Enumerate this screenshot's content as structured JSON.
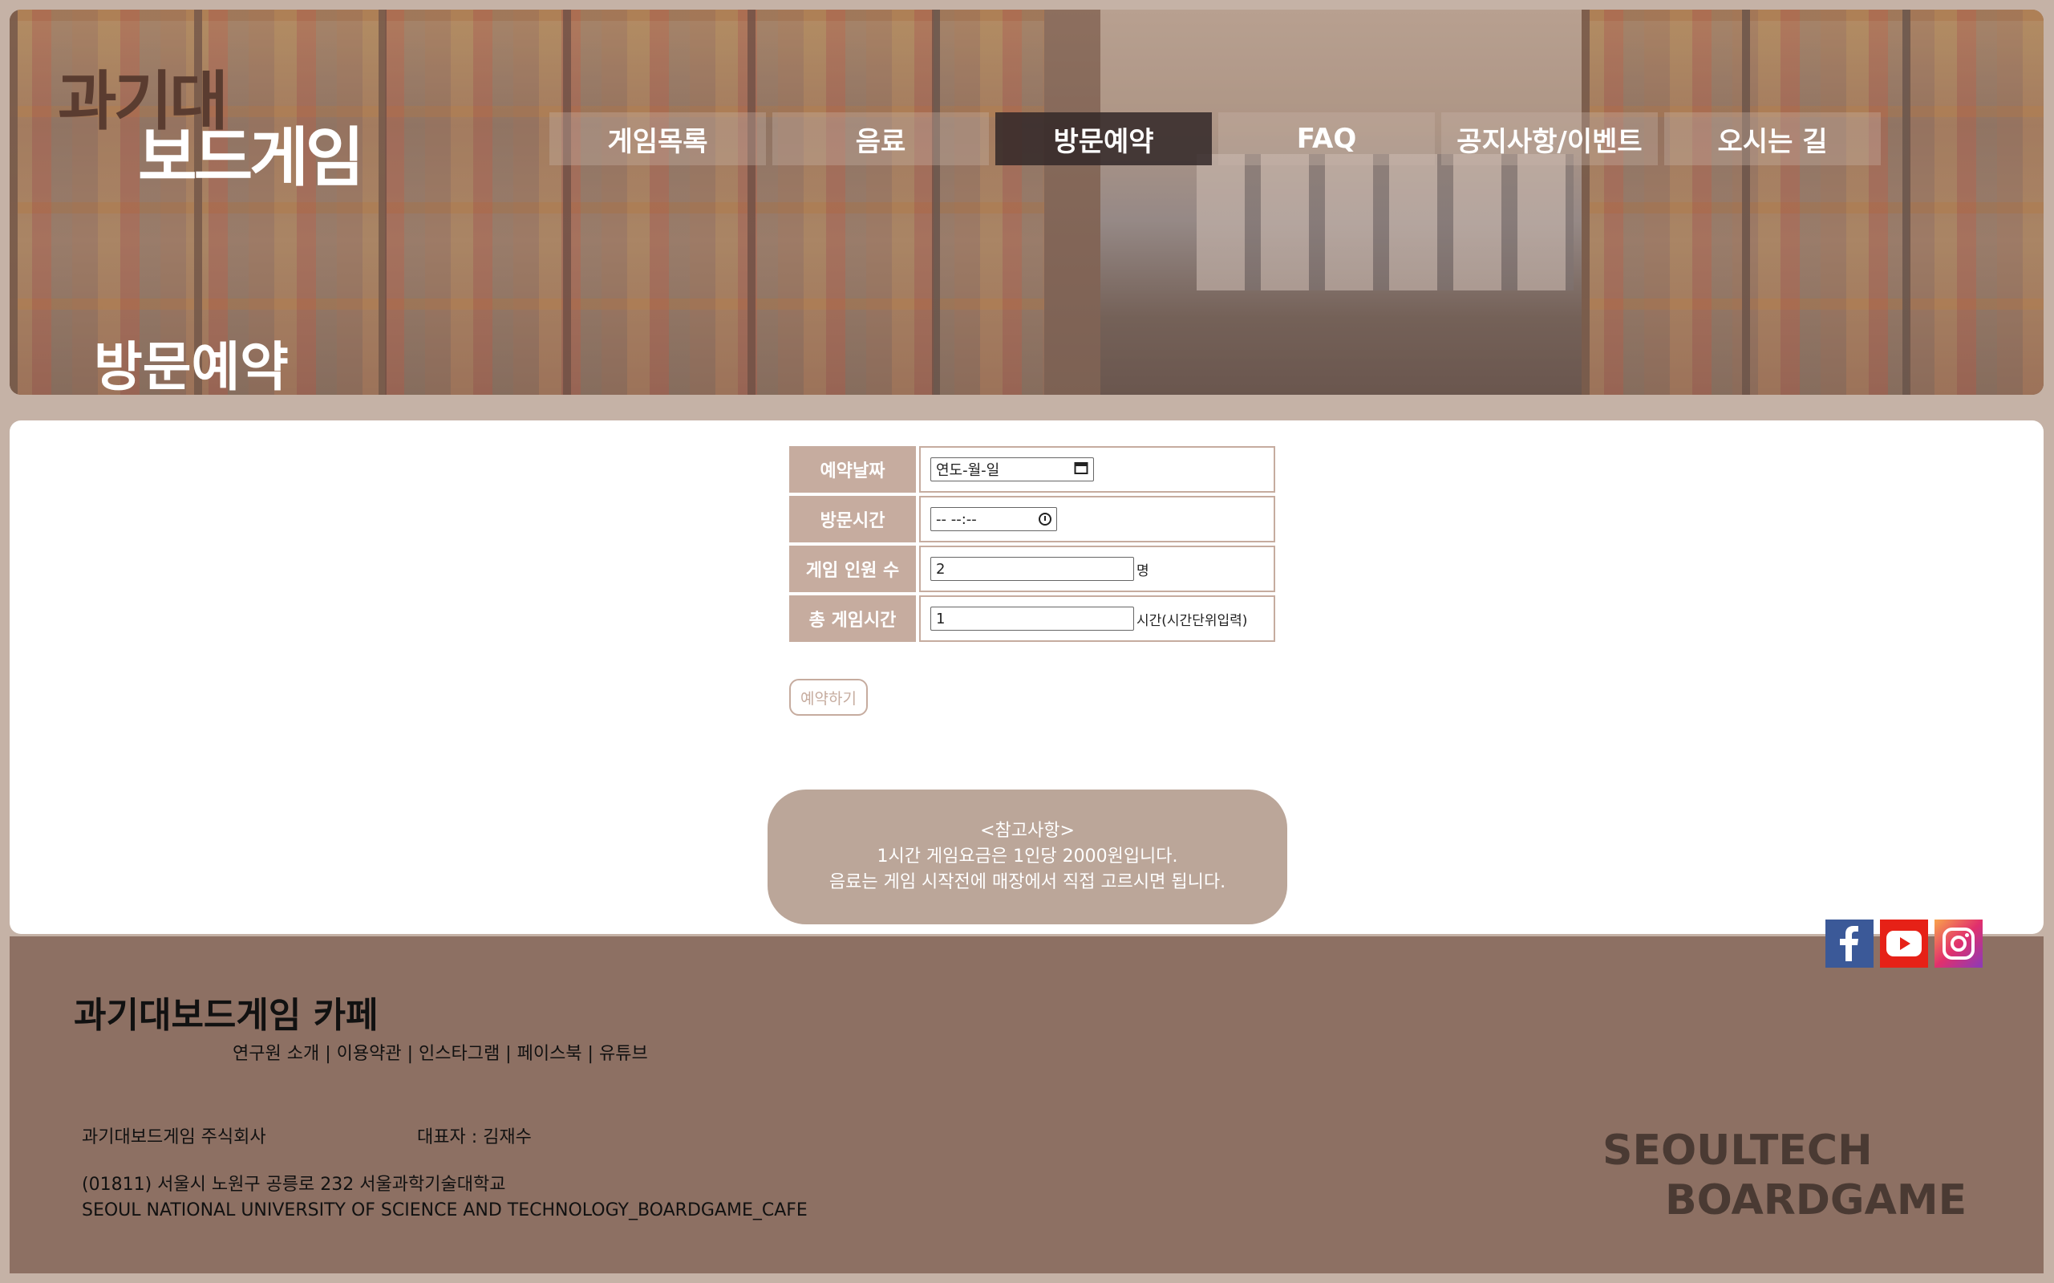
{
  "logo": {
    "line1": "과기대",
    "line2": "보드게임"
  },
  "nav": [
    {
      "label": "게임목록",
      "active": false
    },
    {
      "label": "음료",
      "active": false
    },
    {
      "label": "방문예약",
      "active": true
    },
    {
      "label": "FAQ",
      "active": false
    },
    {
      "label": "공지사항/이벤트",
      "active": false
    },
    {
      "label": "오시는 길",
      "active": false
    }
  ],
  "hero": {
    "title": "방문예약"
  },
  "form": {
    "date_label": "예약날짜",
    "date_value": "연도-월-일",
    "time_label": "방문시간",
    "time_value": "-- --:--",
    "people_label": "게임 인원 수",
    "people_value": "2",
    "people_unit": "명",
    "hours_label": "총 게임시간",
    "hours_value": "1",
    "hours_unit": "시간(시간단위입력)",
    "submit_label": "예약하기"
  },
  "notice": {
    "line1": "<참고사항>",
    "line2": "1시간 게임요금은 1인당 2000원입니다.",
    "line3": "음료는 게임 시작전에 매장에서 직접 고르시면 됩니다."
  },
  "social": {
    "icons": [
      "facebook-icon",
      "youtube-icon",
      "instagram-icon"
    ],
    "colors": {
      "facebook": "#3b5998",
      "youtube": "#e62117",
      "instagram": "#e1306c"
    }
  },
  "footer": {
    "title": "과기대보드게임 카페",
    "links": [
      "연구원 소개",
      "이용약관",
      "인스타그램",
      "페이스북",
      "유튜브"
    ],
    "company": "과기대보드게임 주식회사",
    "ceo": "대표자 : 김재수",
    "address": "(01811) 서울시 노원구 공릉로 232 서울과학기술대학교",
    "address_en": "SEOUL NATIONAL UNIVERSITY OF SCIENCE AND TECHNOLOGY_BOARDGAME_CAFE",
    "brand_line1": "SEOULTECH",
    "brand_line2": "BOARDGAME"
  },
  "colors": {
    "page_bg": "#c5b2a6",
    "label_bg": "#c6ac9f",
    "notice_bg": "#bba699",
    "footer_bg": "#8d7063"
  }
}
